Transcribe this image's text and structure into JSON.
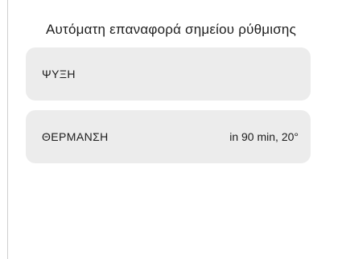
{
  "title": "Αυτόματη επαναφορά σημείου ρύθμισης",
  "items": [
    {
      "label": "ΨΥΞΗ",
      "value": ""
    },
    {
      "label": "ΘΕΡΜΑΝΣΗ",
      "value": "in 90 min, 20°"
    }
  ]
}
